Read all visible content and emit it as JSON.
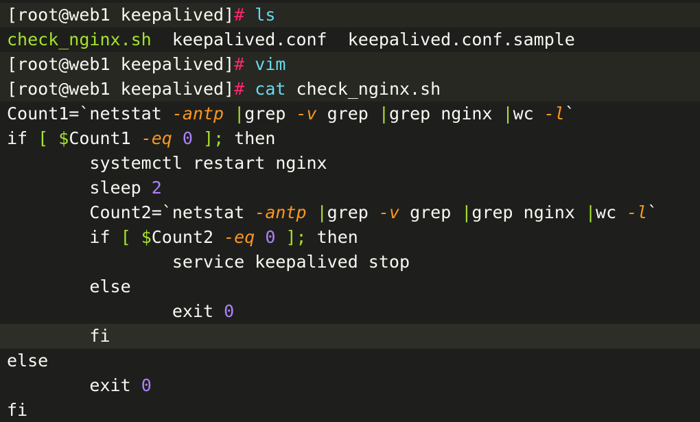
{
  "terminal": {
    "prompt_user": "[root@web1 keepalived]",
    "prompt_symbol": "#",
    "commands": {
      "ls": "ls",
      "vim": "vim",
      "cat": "cat",
      "cat_arg": "check_nginx.sh"
    },
    "ls_output": {
      "file1": "check_nginx.sh",
      "file2": "keepalived.conf",
      "file3": "keepalived.conf.sample"
    }
  },
  "script": {
    "l1": {
      "var": "Count1=",
      "bt_open": "`",
      "cmd1": "netstat ",
      "opt1": "-antp",
      "pipe1": " |",
      "cmd2": "grep ",
      "opt2": "-v",
      "cmd3": " grep ",
      "pipe2": "|",
      "cmd4": "grep nginx ",
      "pipe3": "|",
      "cmd5": "wc ",
      "opt3": "-l",
      "bt_close": "`"
    },
    "l2": {
      "kw_if": "if",
      "br_open": " [ ",
      "dollar": "$",
      "var": "Count1",
      "sp": " ",
      "op": "-eq",
      "sp2": " ",
      "num": "0",
      "br_close": " ];",
      "kw_then": " then"
    },
    "l3": {
      "indent": "        ",
      "text": "systemctl restart nginx"
    },
    "l4": {
      "indent": "        ",
      "cmd": "sleep ",
      "num": "2"
    },
    "l5": {
      "indent": "        ",
      "var": "Count2=",
      "bt_open": "`",
      "cmd1": "netstat ",
      "opt1": "-antp",
      "pipe1": " |",
      "cmd2": "grep ",
      "opt2": "-v",
      "cmd3": " grep ",
      "pipe2": "|",
      "cmd4": "grep nginx ",
      "pipe3": "|",
      "cmd5": "wc ",
      "opt3": "-l",
      "bt_close": "`"
    },
    "l6": {
      "indent": "        ",
      "kw_if": "if",
      "br_open": " [ ",
      "dollar": "$",
      "var": "Count2",
      "sp": " ",
      "op": "-eq",
      "sp2": " ",
      "num": "0",
      "br_close": " ];",
      "kw_then": " then"
    },
    "l7": {
      "indent": "                ",
      "text": "service keepalived stop"
    },
    "l8": {
      "indent": "        ",
      "text": "else"
    },
    "l9": {
      "indent": "                ",
      "cmd": "exit ",
      "num": "0"
    },
    "l10": {
      "indent": "        ",
      "text": "fi"
    },
    "l11": {
      "text": "else"
    },
    "l12": {
      "indent": "        ",
      "cmd": "exit ",
      "num": "0"
    },
    "l13": {
      "text": "fi"
    }
  },
  "colors": {
    "background": "#1e1f1c",
    "green": "#a6e22e",
    "pink": "#f92672",
    "cyan": "#66d9ef",
    "orange": "#fd971f",
    "purple": "#ae81ff"
  }
}
